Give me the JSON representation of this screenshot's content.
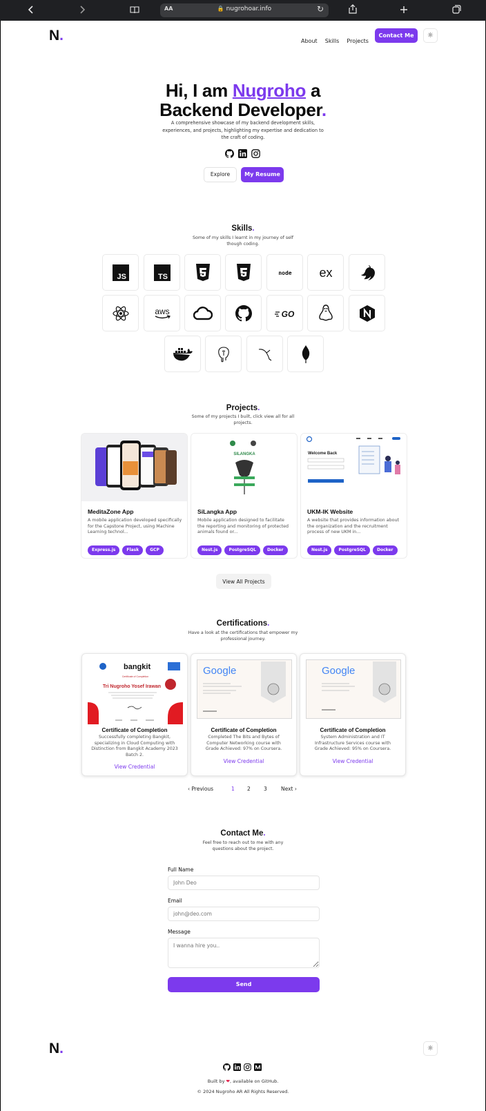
{
  "browser": {
    "url": "nugrohoar.info",
    "aa_label": "AA",
    "back_icon": "chevron-left-icon",
    "forward_icon": "chevron-right-icon"
  },
  "header": {
    "logo": "N",
    "logo_dot": ".",
    "nav": [
      "About",
      "Skills",
      "Projects"
    ],
    "contact_button": "Contact Me",
    "theme_icon": "sun-icon"
  },
  "hero": {
    "line1_prefix": "Hi, I am",
    "name": "Nugroho",
    "line1_suffix": "a",
    "line2": "Backend Developer",
    "line2_dot": ".",
    "description": "A comprehensive showcase of my backend development skills, experiences, and projects, highlighting my expertise and dedication to the craft of coding.",
    "socials": [
      "github-icon",
      "linkedin-icon",
      "instagram-icon"
    ],
    "explore_button": "Explore",
    "resume_button": "My Resume"
  },
  "skills": {
    "title": "Skills",
    "subtitle": "Some of my skills I learnt in my journey of self though coding.",
    "items": [
      "javascript-icon",
      "typescript-icon",
      "html5-icon",
      "css3-icon",
      "nodejs-icon",
      "express-icon",
      "nestjs-icon",
      "react-icon",
      "aws-icon",
      "google-cloud-icon",
      "github-icon",
      "go-icon",
      "linux-icon",
      "nginx-icon",
      "docker-icon",
      "postgresql-icon",
      "mysql-icon",
      "mongodb-icon"
    ],
    "labels": {
      "js": "JS",
      "ts": "TS",
      "node": "node",
      "express": "ex",
      "aws": "aws",
      "go": "GO"
    }
  },
  "projects": {
    "title": "Projects",
    "subtitle": "Some of my projects I built, click view all for all projects.",
    "items": [
      {
        "title": "MeditaZone App",
        "description": "A mobile application developed specifically for the Capstone Project, using Machine Learning technol...",
        "tags": [
          "Express.js",
          "Flask",
          "GCP"
        ]
      },
      {
        "title": "SiLangka App",
        "description": "Mobile application designed to facilitate the reporting and monitoring of protected animals found or...",
        "tags": [
          "Nest.js",
          "PostgreSQL",
          "Docker"
        ],
        "shot_text": "SILANGKA"
      },
      {
        "title": "UKM-IK Website",
        "description": "A website that provides information about the organization and the recruitment process of new UKM in...",
        "tags": [
          "Nest.js",
          "PostgreSQL",
          "Docker"
        ],
        "shot_text": "Welcome Back"
      }
    ],
    "view_all_button": "View All Projects"
  },
  "certifications": {
    "title": "Certifications",
    "subtitle": "Have a look at the certifications that empower my professional journey.",
    "items": [
      {
        "title": "Certificate of Completion",
        "description": "Successfully completing Bangkit, specializing in Cloud Computing with Distinction from Bangkit Academy 2023 Batch 2.",
        "link": "View Credential",
        "image_brand": "bangkit",
        "image_name": "Tri Nugroho Yosef Irawan",
        "image_heading": "Certificate of Completion"
      },
      {
        "title": "Certificate of Completion",
        "description": "Completed The Bits and Bytes of Computer Networking course with Grade Achieved: 97% on Coursera.",
        "link": "View Credential",
        "image_brand": "Google"
      },
      {
        "title": "Certificate of Completion",
        "description": "System Administration and IT Infrastructure Services course with Grade Achieved: 95% on Coursera.",
        "link": "View Credential",
        "image_brand": "Google"
      }
    ],
    "pagination": {
      "previous": "Previous",
      "pages": [
        "1",
        "2",
        "3"
      ],
      "current": "1",
      "next": "Next"
    }
  },
  "contact": {
    "title": "Contact Me",
    "subtitle": "Feel free to reach out to me with any questions about the project.",
    "name_label": "Full Name",
    "name_placeholder": "John Deo",
    "email_label": "Email",
    "email_placeholder": "john@deo.com",
    "message_label": "Message",
    "message_placeholder": "I wanna hire you..",
    "send_button": "Send"
  },
  "footer": {
    "logo": "N",
    "logo_dot": ".",
    "socials": [
      "github-icon",
      "linkedin-icon",
      "instagram-icon",
      "medium-icon"
    ],
    "built_prefix": "Built by",
    "built_suffix": ", available on GitHub.",
    "copyright": "© 2024 Nugroho AR All Rights Reserved."
  },
  "colors": {
    "accent": "#7c3aed",
    "text": "#111111",
    "heart": "#e11d48"
  }
}
